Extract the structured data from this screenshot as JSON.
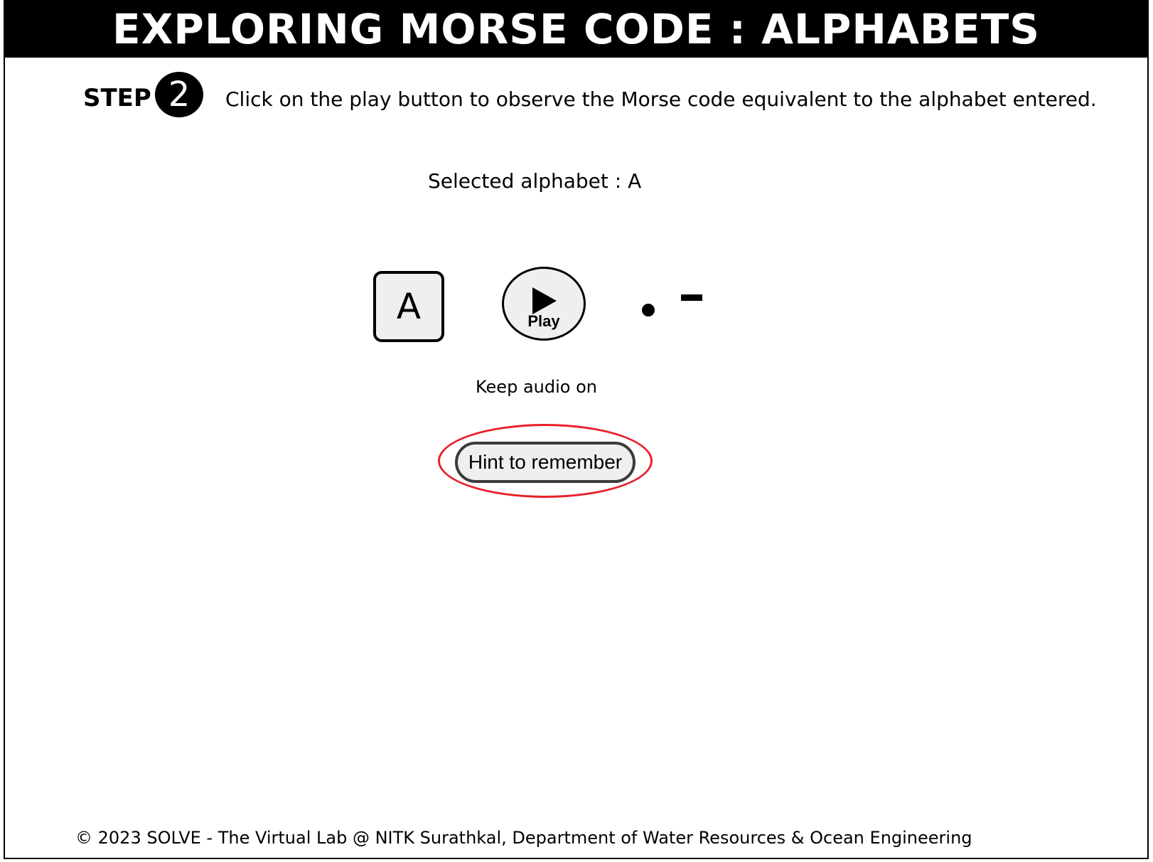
{
  "header": {
    "title": "EXPLORING MORSE CODE : ALPHABETS"
  },
  "step": {
    "label": "STEP",
    "number": "2",
    "instruction": "Click on the play button to observe the Morse code equivalent to the alphabet entered."
  },
  "selection": {
    "text": "Selected alphabet : A",
    "key_letter": "A"
  },
  "player": {
    "play_label": "Play",
    "play_icon": "play-triangle-icon",
    "morse_symbols": [
      "dot",
      "dash"
    ],
    "audio_note": "Keep audio on"
  },
  "hint": {
    "button_label": "Hint to remember",
    "highlight_color": "#e8202a"
  },
  "footer": {
    "copyright": "© 2023 SOLVE - The Virtual Lab @ NITK Surathkal, Department of Water Resources & Ocean Engineering"
  }
}
